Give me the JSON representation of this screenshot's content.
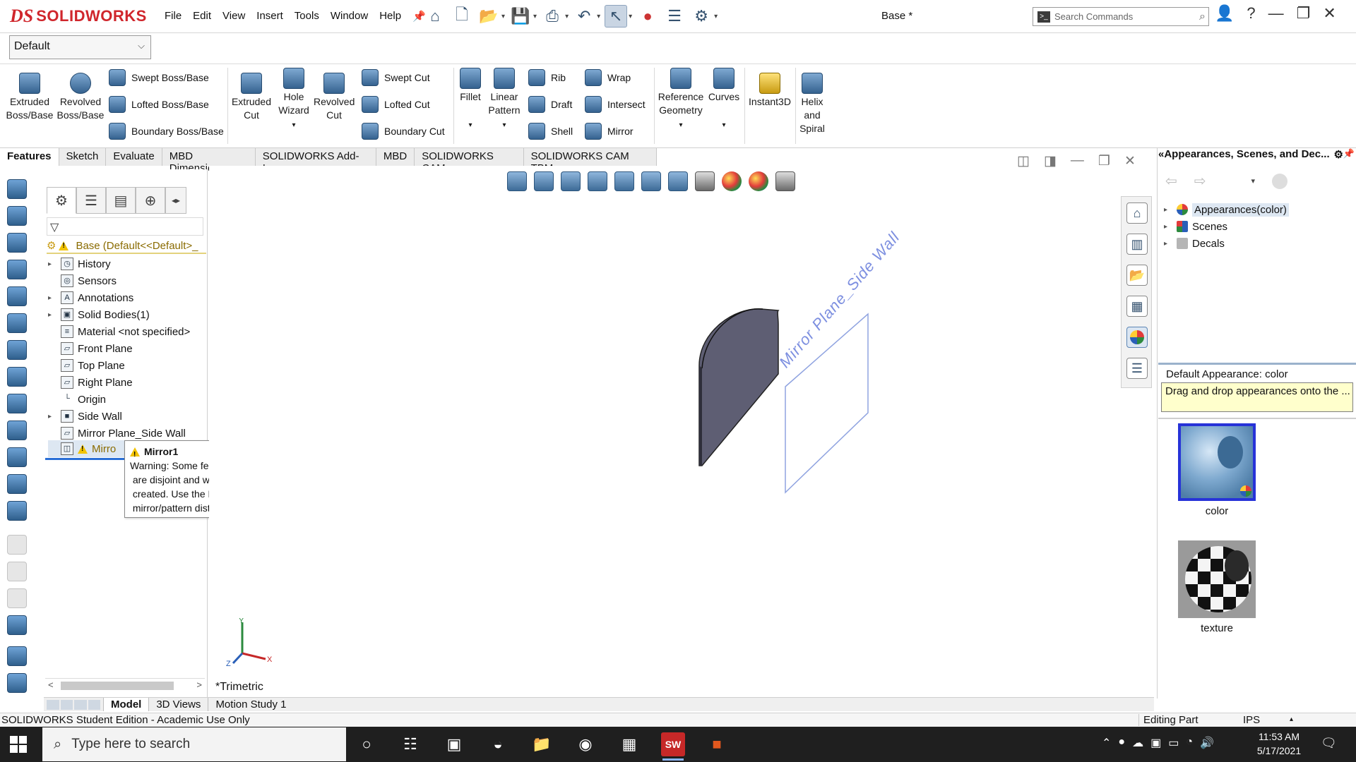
{
  "app": {
    "brand_ds": "DS",
    "brand_name": "SOLIDWORKS",
    "doc_title": "Base *",
    "search_placeholder": "Search Commands"
  },
  "menu": [
    "File",
    "Edit",
    "View",
    "Insert",
    "Tools",
    "Window",
    "Help"
  ],
  "config": {
    "selected": "Default"
  },
  "ribbon": {
    "extruded_boss": [
      "Extruded",
      "Boss/Base"
    ],
    "revolved_boss": [
      "Revolved",
      "Boss/Base"
    ],
    "swept_boss": "Swept Boss/Base",
    "lofted_boss": "Lofted Boss/Base",
    "boundary_boss": "Boundary Boss/Base",
    "extruded_cut": [
      "Extruded",
      "Cut"
    ],
    "hole_wizard": [
      "Hole",
      "Wizard"
    ],
    "revolved_cut": [
      "Revolved",
      "Cut"
    ],
    "swept_cut": "Swept Cut",
    "lofted_cut": "Lofted Cut",
    "boundary_cut": "Boundary Cut",
    "fillet": "Fillet",
    "linear_pattern": [
      "Linear",
      "Pattern"
    ],
    "rib": "Rib",
    "draft": "Draft",
    "shell": "Shell",
    "wrap": "Wrap",
    "intersect": "Intersect",
    "mirror": "Mirror",
    "reference_geometry": [
      "Reference",
      "Geometry"
    ],
    "curves": "Curves",
    "instant3d": "Instant3D",
    "helix": [
      "Helix",
      "and",
      "Spiral"
    ]
  },
  "tabs": [
    "Features",
    "Sketch",
    "Evaluate",
    "MBD Dimensions",
    "SOLIDWORKS Add-Ins",
    "MBD",
    "SOLIDWORKS CAM",
    "SOLIDWORKS CAM TBM"
  ],
  "tree": {
    "root": "Base  (Default<<Default>_",
    "items": [
      {
        "label": "History",
        "icon": "history-icon",
        "arrow": true
      },
      {
        "label": "Sensors",
        "icon": "sensors-icon",
        "arrow": false
      },
      {
        "label": "Annotations",
        "icon": "annotations-icon",
        "arrow": true
      },
      {
        "label": "Solid Bodies(1)",
        "icon": "solid-bodies-icon",
        "arrow": true
      },
      {
        "label": "Material <not specified>",
        "icon": "material-icon",
        "arrow": false
      },
      {
        "label": "Front Plane",
        "icon": "plane-icon",
        "arrow": false
      },
      {
        "label": "Top Plane",
        "icon": "plane-icon",
        "arrow": false
      },
      {
        "label": "Right Plane",
        "icon": "plane-icon",
        "arrow": false
      },
      {
        "label": "Origin",
        "icon": "origin-icon",
        "arrow": false
      },
      {
        "label": "Side Wall",
        "icon": "extrude-feature-icon",
        "arrow": true
      },
      {
        "label": "Mirror Plane_Side Wall",
        "icon": "plane-icon",
        "arrow": false
      },
      {
        "label": "Mirro",
        "icon": "mirror-feature-icon",
        "arrow": false
      }
    ]
  },
  "tooltip": {
    "title": "Mirror1",
    "lines": [
      "Warning: Some feature instances",
      " are disjoint and will not be",
      " created. Use the Bodies option to",
      " mirror/pattern distinct bodies."
    ]
  },
  "graphics": {
    "plane_label": "Mirror Plane_Side Wall",
    "view_label": "*Trimetric",
    "triad_x": "X",
    "triad_y": "Y",
    "triad_z": "Z"
  },
  "right_pane": {
    "title": "Appearances, Scenes, and Dec...",
    "items": [
      {
        "label": "Appearances(color)",
        "selected": true
      },
      {
        "label": "Scenes",
        "selected": false
      },
      {
        "label": "Decals",
        "selected": false
      }
    ],
    "default_appearance": "Default Appearance: color",
    "hint": "Drag and drop appearances onto the ...",
    "thumb1": "color",
    "thumb2": "texture"
  },
  "model_tabs": [
    "Model",
    "3D Views",
    "Motion Study 1"
  ],
  "status": {
    "left": "SOLIDWORKS Student Edition - Academic Use Only",
    "editing": "Editing Part",
    "units": "IPS"
  },
  "taskbar": {
    "search_placeholder": "Type here to search",
    "time": "11:53 AM",
    "date": "5/17/2021",
    "sw_badge": "SW"
  }
}
